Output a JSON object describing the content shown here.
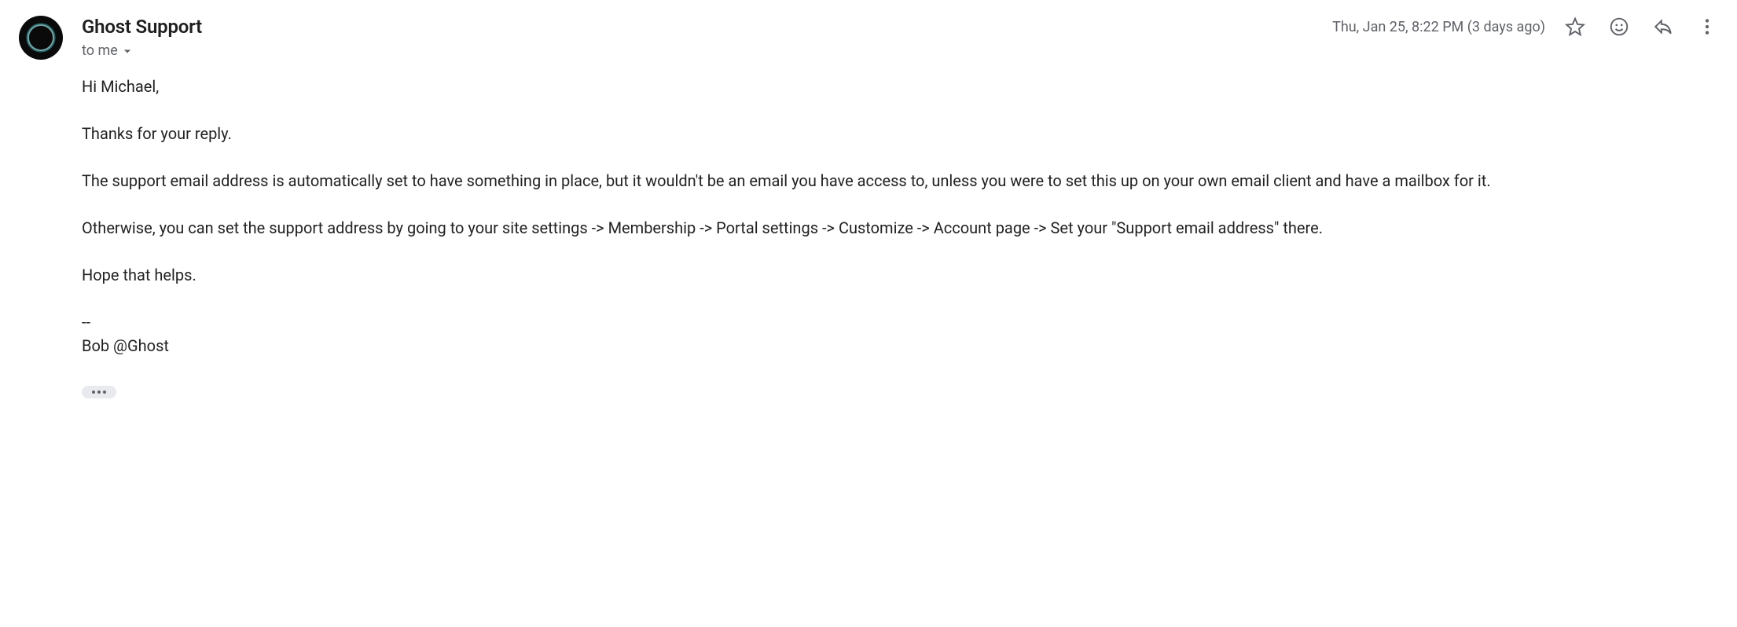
{
  "sender": {
    "name": "Ghost Support"
  },
  "recipient": {
    "label": "to me"
  },
  "timestamp": "Thu, Jan 25, 8:22 PM (3 days ago)",
  "body": {
    "greeting": "Hi Michael,",
    "p1": "Thanks for your reply.",
    "p2": "The support email address is automatically set to have something in place, but it wouldn't be an email you have access to, unless you were to set this up on your own email client and have a mailbox for it.",
    "p3": "Otherwise, you can set the support address by going to your site settings -> Membership -> Portal settings -> Customize -> Account page -> Set your \"Support email address\" there.",
    "p4": "Hope that helps."
  },
  "signature": {
    "divider": "--",
    "name": "Bob @Ghost"
  }
}
